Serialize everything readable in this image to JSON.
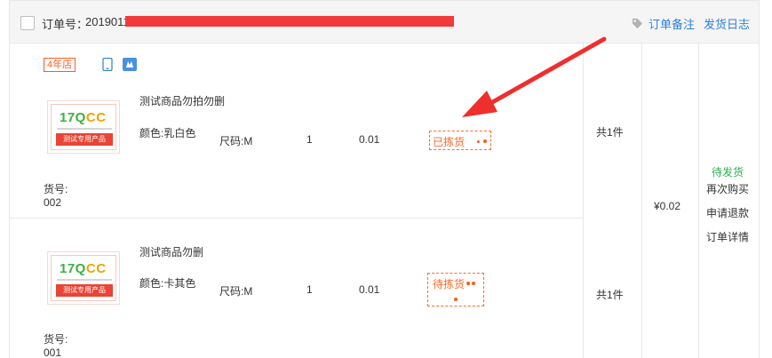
{
  "order": {
    "order_no_label": "订单号：",
    "order_no_value": "2019011",
    "links": {
      "remark": "订单备注",
      "shipping_log": "发货日志"
    }
  },
  "shop": {
    "badge": "4年店"
  },
  "items": [
    {
      "title": "测试商品勿拍勿删",
      "color": "颜色:乳白色",
      "size": "尺码:M",
      "qty": "1",
      "price": "0.01",
      "status": "已拣货",
      "item_no_label": "货号:",
      "item_no": "002",
      "count": "共1件"
    },
    {
      "title": "测试商品勿删",
      "color": "颜色:卡其色",
      "size": "尺码:M",
      "qty": "1",
      "price": "0.01",
      "status": "待拣货",
      "item_no_label": "货号:",
      "item_no": "001",
      "count": "共1件"
    }
  ],
  "thumbnail": {
    "logo_a": "17Q",
    "logo_b": "CC",
    "banner": "测试专用产品"
  },
  "summary": {
    "total": "¥0.02",
    "status": "待发货",
    "actions": [
      "再次购买",
      "申请退款",
      "订单详情"
    ]
  },
  "colors": {
    "accent_blue": "#2f7fd6",
    "status_orange": "#ff6a2a",
    "status_green": "#2bb24c",
    "redaction_red": "#f23a3a"
  },
  "icons": [
    "tag-icon",
    "phone-icon",
    "mini-program-icon",
    "annotation-arrow"
  ]
}
